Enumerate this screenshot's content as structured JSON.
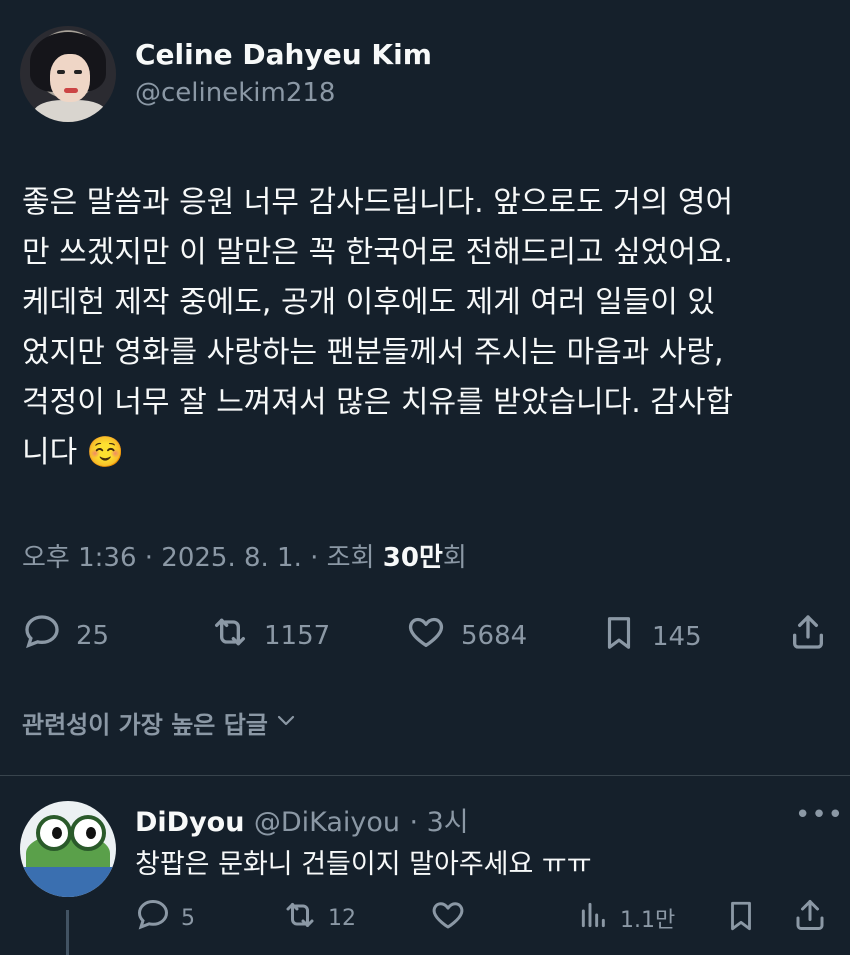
{
  "tweet": {
    "author_name": "Celine Dahyeu Kim",
    "author_handle": "@celinekim218",
    "lines": [
      "좋은 말씀과 응원 너무 감사드립니다. 앞으로도 거의 영어",
      "만 쓰겠지만 이 말만은 꼭 한국어로 전해드리고 싶었어요.",
      "케데헌 제작 중에도, 공개 이후에도 제게 여러 일들이 있",
      "었지만 영화를 사랑하는 팬분들께서 주시는 마음과 사랑,",
      "걱정이 너무 잘 느껴져서 많은 치유를 받았습니다. 감사합",
      "니다 ☺️"
    ],
    "meta_prefix": "오후 1:36 · 2025. 8. 1. · 조회 ",
    "views": "30만",
    "views_suffix": "회",
    "replies": "25",
    "reposts": "1157",
    "likes": "5684",
    "bookmarks": "145"
  },
  "sort": {
    "label": "관련성이 가장 높은 답글"
  },
  "reply": {
    "author_name": "DiDyou",
    "author_handle": "@DiKaiyou",
    "time": "· 3시",
    "text": "창팝은 문화니 건들이지 말아주세요 ㅠㅠ",
    "replies": "5",
    "reposts": "12",
    "views": "1.1만"
  },
  "icons": {
    "reply": "reply-icon",
    "repost": "repost-icon",
    "like": "heart-icon",
    "bookmark": "bookmark-icon",
    "share": "share-icon",
    "views": "views-icon",
    "more": "more-icon",
    "chevron": "chevron-down-icon"
  }
}
